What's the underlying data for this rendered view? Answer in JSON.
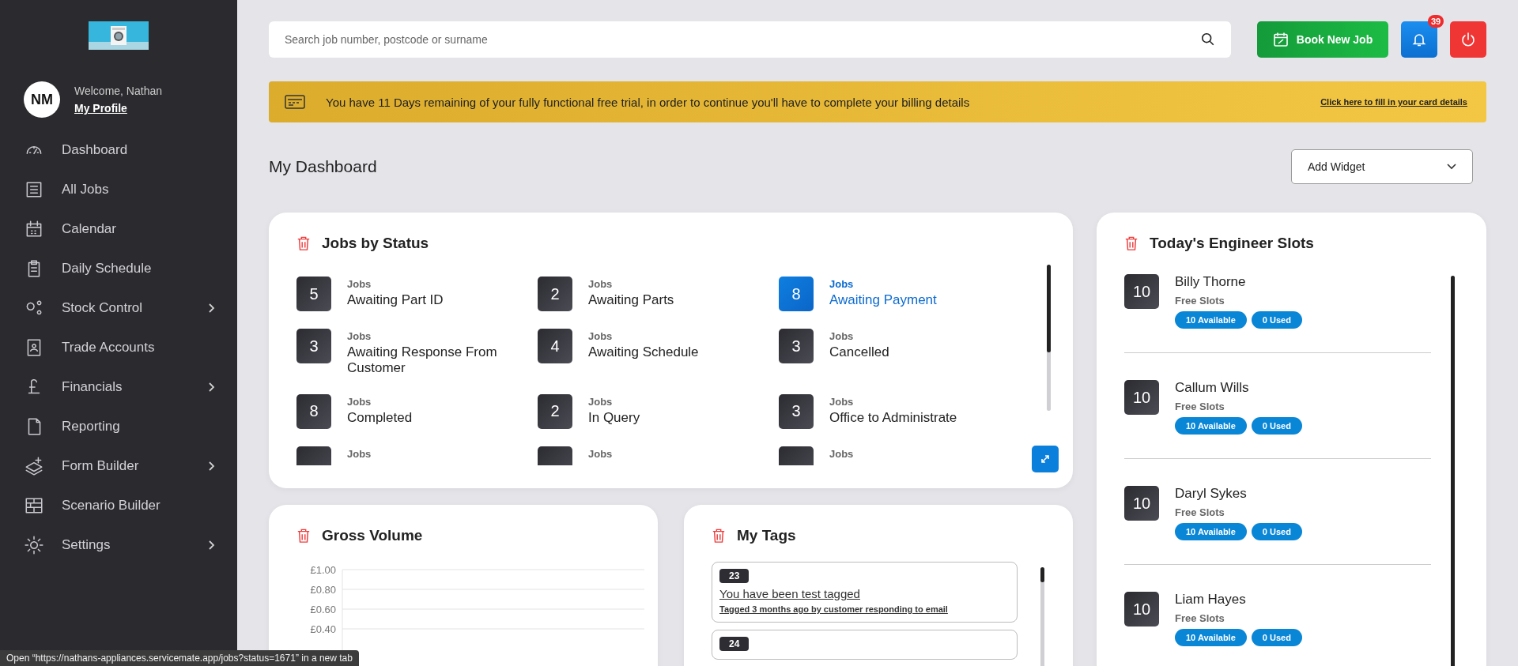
{
  "sidebar": {
    "welcome": "Welcome, Nathan",
    "profile_link": "My Profile",
    "avatar_initials": "NM",
    "items": [
      {
        "label": "Dashboard",
        "expandable": false
      },
      {
        "label": "All Jobs",
        "expandable": false
      },
      {
        "label": "Calendar",
        "expandable": false
      },
      {
        "label": "Daily Schedule",
        "expandable": false
      },
      {
        "label": "Stock Control",
        "expandable": true
      },
      {
        "label": "Trade Accounts",
        "expandable": false
      },
      {
        "label": "Financials",
        "expandable": true
      },
      {
        "label": "Reporting",
        "expandable": false
      },
      {
        "label": "Form Builder",
        "expandable": true
      },
      {
        "label": "Scenario Builder",
        "expandable": false
      },
      {
        "label": "Settings",
        "expandable": true
      }
    ]
  },
  "search": {
    "placeholder": "Search job number, postcode or surname"
  },
  "header": {
    "book_button": "Book New Job",
    "notification_count": "39"
  },
  "banner": {
    "message": "You have 11 Days remaining of your fully functional free trial, in order to continue you'll have to complete your billing details",
    "link": "Click here to fill in your card details"
  },
  "page_title": "My Dashboard",
  "add_widget": {
    "value": "Add Widget"
  },
  "jobs_by_status": {
    "title": "Jobs by Status",
    "items": [
      {
        "kind": "full",
        "count": "5",
        "caption": "Jobs",
        "status": "Awaiting Part ID",
        "selected": false
      },
      {
        "kind": "full",
        "count": "2",
        "caption": "Jobs",
        "status": "Awaiting Parts",
        "selected": false
      },
      {
        "kind": "full",
        "count": "8",
        "caption": "Jobs",
        "status": "Awaiting Payment",
        "selected": true
      },
      {
        "kind": "full",
        "count": "3",
        "caption": "Jobs",
        "status": "Awaiting Response From Customer",
        "selected": false
      },
      {
        "kind": "full",
        "count": "4",
        "caption": "Jobs",
        "status": "Awaiting Schedule",
        "selected": false
      },
      {
        "kind": "full",
        "count": "3",
        "caption": "Jobs",
        "status": "Cancelled",
        "selected": false
      },
      {
        "kind": "full",
        "count": "8",
        "caption": "Jobs",
        "status": "Completed",
        "selected": false
      },
      {
        "kind": "full",
        "count": "2",
        "caption": "Jobs",
        "status": "In Query",
        "selected": false
      },
      {
        "kind": "full",
        "count": "3",
        "caption": "Jobs",
        "status": "Office to Administrate",
        "selected": false
      },
      {
        "kind": "partial",
        "caption": "Jobs",
        "selected": false
      },
      {
        "kind": "partial",
        "caption": "Jobs",
        "selected": false
      },
      {
        "kind": "partial",
        "caption": "Jobs",
        "selected": false
      }
    ]
  },
  "engineer_slots": {
    "title": "Today's Engineer Slots",
    "engineers": [
      {
        "count": "10",
        "name": "Billy Thorne",
        "caption": "Free Slots",
        "available": "10 Available",
        "used": "0 Used"
      },
      {
        "count": "10",
        "name": "Callum Wills",
        "caption": "Free Slots",
        "available": "10 Available",
        "used": "0 Used"
      },
      {
        "count": "10",
        "name": "Daryl Sykes",
        "caption": "Free Slots",
        "available": "10 Available",
        "used": "0 Used"
      },
      {
        "count": "10",
        "name": "Liam Hayes",
        "caption": "Free Slots",
        "available": "10 Available",
        "used": "0 Used"
      }
    ]
  },
  "gross_volume": {
    "title": "Gross Volume",
    "axis_labels": [
      "£1.00",
      "£0.80",
      "£0.60",
      "£0.40"
    ]
  },
  "my_tags": {
    "title": "My Tags",
    "tags": [
      {
        "number": "23",
        "text": "You have been test tagged",
        "meta": "Tagged 3 months ago by customer responding to email"
      },
      {
        "number": "24"
      }
    ]
  },
  "status_tooltip": "Open “https://nathans-appliances.servicemate.app/jobs?status=1671” in a new tab"
}
